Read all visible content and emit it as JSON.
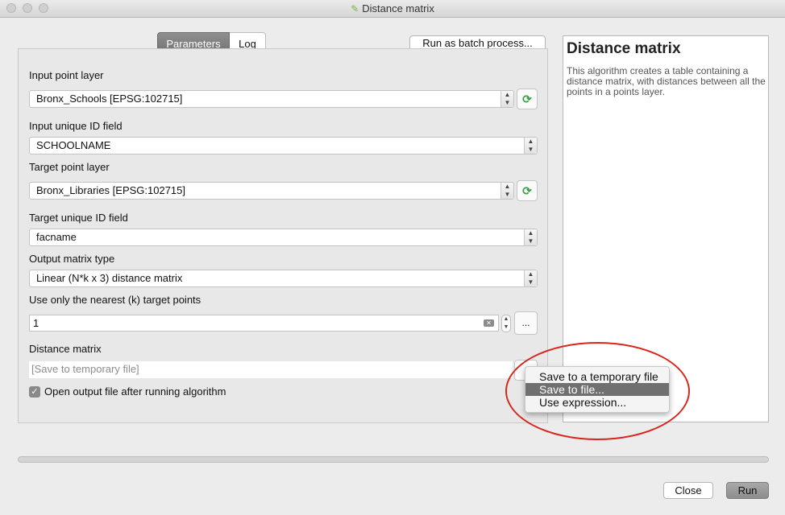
{
  "window": {
    "title": "Distance matrix"
  },
  "tabs": [
    {
      "label": "Parameters"
    },
    {
      "label": "Log"
    }
  ],
  "batch_button": "Run as batch process...",
  "params": {
    "input_layer": {
      "label": "Input point layer",
      "value": "Bronx_Schools [EPSG:102715]"
    },
    "input_id": {
      "label": "Input unique ID field",
      "value": "SCHOOLNAME"
    },
    "target_layer": {
      "label": "Target point layer",
      "value": "Bronx_Libraries [EPSG:102715]"
    },
    "target_id": {
      "label": "Target unique ID field",
      "value": "facname"
    },
    "matrix_type": {
      "label": "Output matrix type",
      "value": "Linear (N*k x 3) distance matrix"
    },
    "nearest_k": {
      "label": "Use only the nearest (k) target points",
      "value": "1"
    },
    "output": {
      "label": "Distance matrix",
      "placeholder": "[Save to temporary file]"
    },
    "open_output": {
      "label": "Open output file after running algorithm",
      "checked": true
    }
  },
  "help": {
    "title": "Distance matrix",
    "description": "This algorithm creates a table containing a distance matrix, with distances between all the points in a points layer."
  },
  "menu": {
    "items": [
      "Save to a temporary file",
      "Save to file...",
      "Use expression..."
    ],
    "highlighted_index": 1
  },
  "buttons": {
    "close": "Close",
    "run": "Run",
    "more": "..."
  },
  "colors": {
    "annotation_circle": "#d9261c",
    "highlight": "#707070"
  }
}
